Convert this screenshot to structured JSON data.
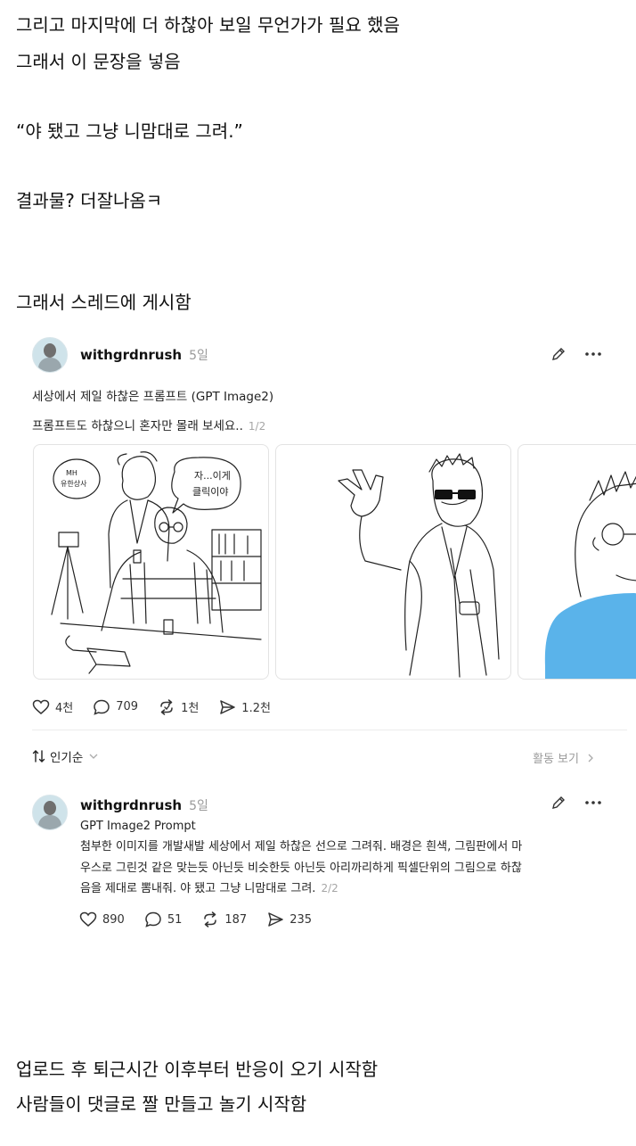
{
  "paragraphs": {
    "p1": "그리고 마지막에 더 하찮아 보일 무언가가 필요 했음",
    "p2": "그래서 이 문장을 넣음",
    "p3": "“야 됐고 그냥 니맘대로 그려.”",
    "p4": "결과물? 더잘나옴ㅋ",
    "p5": "그래서 스레드에 게시함",
    "p6": "업로드 후 퇴근시간 이후부터 반응이 오기 시작함",
    "p7": "사람들이 댓글로 짤 만들고 놀기 시작함"
  },
  "post": {
    "username": "withgrdnrush",
    "time": "5일",
    "line1": "세상에서 제일 하찮은 프롬프트 (GPT Image2)",
    "line2": "프롬프트도 하찮으니 혼자만 몰래 보세요..",
    "page": "1/2",
    "images": {
      "speech_left": "MH 유한상사",
      "speech_right": "자...이게 클릭이야"
    },
    "metrics": {
      "likes": "4천",
      "comments": "709",
      "reposts": "1천",
      "shares": "1.2천"
    }
  },
  "sort": {
    "label": "인기순",
    "activity": "활동 보기"
  },
  "reply": {
    "username": "withgrdnrush",
    "time": "5일",
    "title": "GPT Image2 Prompt",
    "body1": "첨부한 이미지를 개발새발 세상에서 제일 하찮은 선으로 그려줘. 배경은 흰색, 그림판에서 마",
    "body2": "우스로 그린것 같은 맞는듯 아닌듯 비슷한듯 아닌듯 아리까리하게 픽셀단위의 그림으로 하찮",
    "body3": "음을 제대로 뽐내줘. 야 됐고 그냥 니맘대로 그려.",
    "page": "2/2",
    "metrics": {
      "likes": "890",
      "comments": "51",
      "reposts": "187",
      "shares": "235"
    }
  },
  "colors": {
    "blue_fill": "#5ab3ea",
    "muted": "#9a9a9a"
  }
}
